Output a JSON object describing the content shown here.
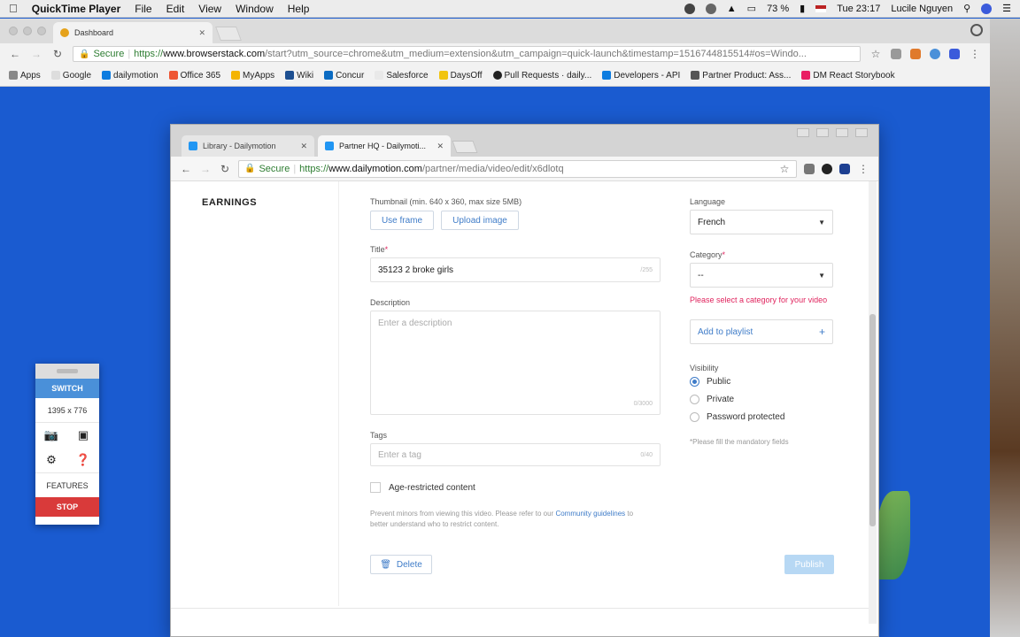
{
  "menubar": {
    "app": "QuickTime Player",
    "items": [
      "File",
      "Edit",
      "View",
      "Window",
      "Help"
    ],
    "battery": "73 %",
    "clock": "Tue 23:17",
    "user": "Lucile Nguyen"
  },
  "outer_browser": {
    "tab_title": "Dashboard",
    "secure_label": "Secure",
    "url_scheme": "https://",
    "url_host": "www.browserstack.com",
    "url_rest": "/start?utm_source=chrome&utm_medium=extension&utm_campaign=quick-launch&timestamp=1516744815514#os=Windo...",
    "bookmarks": [
      "Apps",
      "Google",
      "dailymotion",
      "Office 365",
      "MyApps",
      "Wiki",
      "Concur",
      "Salesforce",
      "DaysOff",
      "Pull Requests · daily...",
      "Developers - API",
      "Partner Product: Ass...",
      "DM React Storybook"
    ]
  },
  "inner_browser": {
    "tabs": [
      {
        "label": "Library - Dailymotion"
      },
      {
        "label": "Partner HQ - Dailymoti..."
      }
    ],
    "secure_label": "Secure",
    "url_scheme": "https://",
    "url_host": "www.dailymotion.com",
    "url_rest": "/partner/media/video/edit/x6dlotq"
  },
  "page": {
    "sidebar_heading": "EARNINGS",
    "thumbnail_label": "Thumbnail (min. 640 x 360, max size 5MB)",
    "use_frame": "Use frame",
    "upload_image": "Upload image",
    "title_label": "Title",
    "title_value": "35123 2 broke girls",
    "title_count": "/255",
    "description_label": "Description",
    "description_placeholder": "Enter a description",
    "description_count": "0/3000",
    "tags_label": "Tags",
    "tags_placeholder": "Enter a tag",
    "tags_count": "0/40",
    "age_restricted": "Age-restricted content",
    "help_text": "Prevent minors from viewing this video. Please refer to our",
    "help_link1": "Community",
    "help_link2": "guidelines",
    "help_text2": "to better understand who to restrict content.",
    "delete": "Delete",
    "publish": "Publish",
    "language_label": "Language",
    "language_value": "French",
    "category_label": "Category",
    "category_value": "--",
    "category_error": "Please select a category for your video",
    "add_playlist": "Add to playlist",
    "visibility_label": "Visibility",
    "visibility_options": [
      "Public",
      "Private",
      "Password protected"
    ],
    "mandatory_note": "*Please fill the mandatory fields"
  },
  "recorder": {
    "switch": "SWITCH",
    "size": "1395 x 776",
    "features": "FEATURES",
    "stop": "STOP"
  }
}
